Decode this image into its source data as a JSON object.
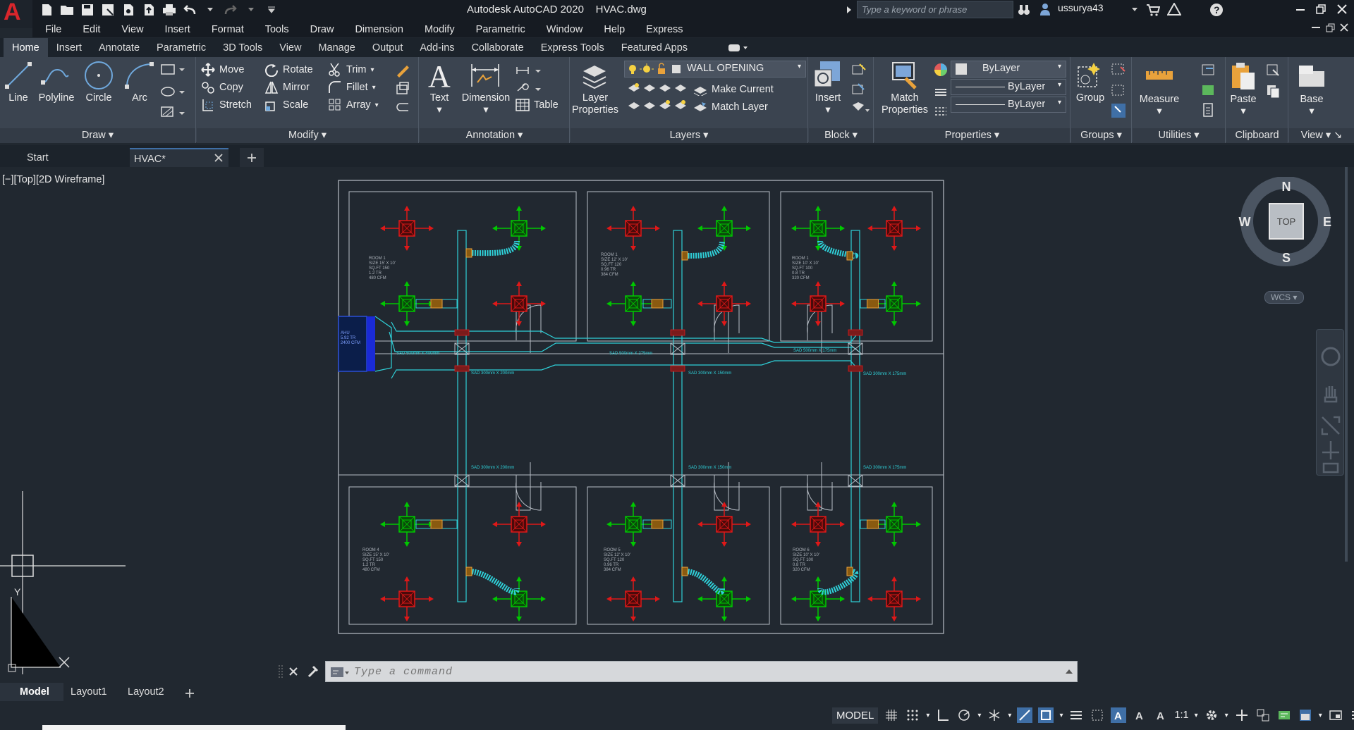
{
  "app": {
    "title": "Autodesk AutoCAD 2020",
    "file": "HVAC.dwg",
    "logo": "A"
  },
  "search": {
    "placeholder": "Type a keyword or phrase"
  },
  "user": {
    "name": "ussurya43"
  },
  "menus": [
    "File",
    "Edit",
    "View",
    "Insert",
    "Format",
    "Tools",
    "Draw",
    "Dimension",
    "Modify",
    "Parametric",
    "Window",
    "Help",
    "Express"
  ],
  "ribbon_tabs": [
    "Home",
    "Insert",
    "Annotate",
    "Parametric",
    "3D Tools",
    "View",
    "Manage",
    "Output",
    "Add-ins",
    "Collaborate",
    "Express Tools",
    "Featured Apps"
  ],
  "panels": {
    "draw": {
      "title": "Draw",
      "line": "Line",
      "polyline": "Polyline",
      "circle": "Circle",
      "arc": "Arc"
    },
    "modify": {
      "title": "Modify",
      "move": "Move",
      "rotate": "Rotate",
      "trim": "Trim",
      "copy": "Copy",
      "mirror": "Mirror",
      "fillet": "Fillet",
      "stretch": "Stretch",
      "scale": "Scale",
      "array": "Array"
    },
    "annotation": {
      "title": "Annotation",
      "text": "Text",
      "dimension": "Dimension",
      "table": "Table"
    },
    "layers": {
      "title": "Layers",
      "layer_properties": "Layer Properties",
      "current_layer": "WALL OPENING",
      "make_current": "Make Current",
      "match_layer": "Match Layer"
    },
    "block": {
      "title": "Block",
      "insert": "Insert"
    },
    "properties": {
      "title": "Properties",
      "match_properties": "Match Properties",
      "color": "ByLayer",
      "linetype": "ByLayer",
      "lineweight": "ByLayer"
    },
    "groups": {
      "title": "Groups",
      "group": "Group"
    },
    "utilities": {
      "title": "Utilities",
      "measure": "Measure"
    },
    "clipboard": {
      "title": "Clipboard",
      "paste": "Paste"
    },
    "view": {
      "title": "View",
      "base": "Base"
    }
  },
  "doc_tabs": [
    "Start",
    "HVAC*"
  ],
  "viewport": {
    "label": "[−][Top][2D Wireframe]"
  },
  "viewcube": {
    "n": "N",
    "s": "S",
    "e": "E",
    "w": "W",
    "face": "TOP",
    "wcs": "WCS"
  },
  "drawing": {
    "rooms_top": [
      [
        "ROOM 1",
        "SIZE 15' X 10'",
        "SQ.FT 150",
        "1.2 TR",
        "480 CFM"
      ],
      [
        "ROOM 1",
        "SIZE 12' X 10'",
        "SQ.FT 120",
        "0.96 TR",
        "384 CFM"
      ],
      [
        "ROOM 1",
        "SIZE 10' X 10'",
        "SQ.FT 100",
        "0.8 TR",
        "320 CFM"
      ]
    ],
    "rooms_bottom": [
      [
        "ROOM 4",
        "SIZE 15' X 10'",
        "SQ.FT 150",
        "1.2 TR",
        "480 CFM"
      ],
      [
        "ROOM 5",
        "SIZE 12' X 10'",
        "SQ.FT 120",
        "0.96 TR",
        "384 CFM"
      ],
      [
        "ROOM 6",
        "SIZE 10' X 10'",
        "SQ.FT 100",
        "0.8 TR",
        "320 CFM"
      ]
    ],
    "ahu": [
      "AHU",
      "5.92 TR",
      "2400 CFM"
    ],
    "duct_labels": {
      "branch_top_1": "SAD 300mm X 200mm",
      "branch_top_2": "SAD 300mm X 150mm",
      "branch_top_3": "SAD 300mm X 175mm",
      "branch_bot_1": "SAD 300mm X 200mm",
      "branch_bot_2": "SAD 300mm X 150mm",
      "branch_bot_3": "SAD 300mm X 175mm",
      "main_1": "SAD 500mm X 400mm",
      "main_2": "SAD 500mm X 275mm",
      "main_3": "SAD 500mm X 175mm"
    }
  },
  "command": {
    "placeholder": "Type a command"
  },
  "layout_tabs": [
    "Model",
    "Layout1",
    "Layout2"
  ],
  "status": {
    "model": "MODEL",
    "scale": "1:1"
  },
  "colors": {
    "accent": "#3f6fa6",
    "duct": "#2fd0d8",
    "supply": "#00c800",
    "return": "#e01818",
    "background": "#212830"
  }
}
